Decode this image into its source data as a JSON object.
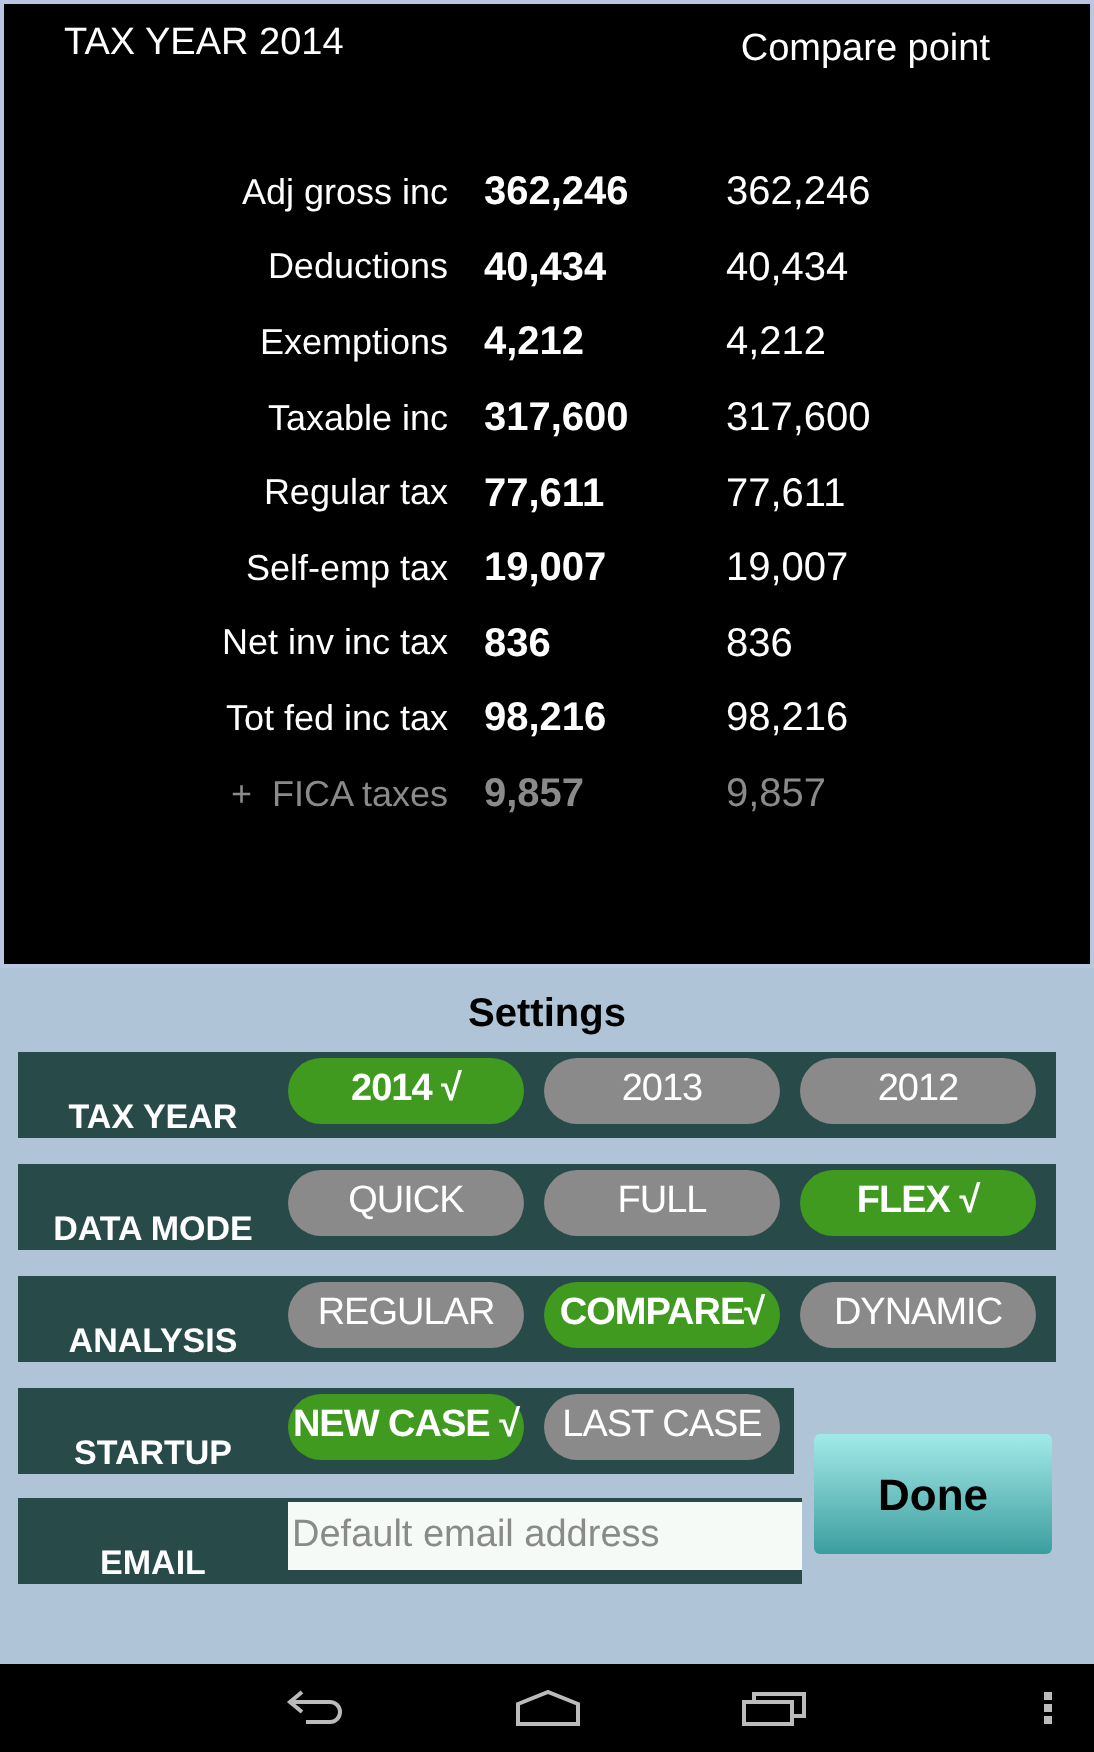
{
  "summary": {
    "title": "TAX YEAR 2014",
    "compare_heading": "Compare point",
    "rows": [
      {
        "label": "Adj gross inc",
        "value": "362,246",
        "compare": "362,246",
        "muted": false
      },
      {
        "label": "Deductions",
        "value": "40,434",
        "compare": "40,434",
        "muted": false
      },
      {
        "label": "Exemptions",
        "value": "4,212",
        "compare": "4,212",
        "muted": false
      },
      {
        "label": "Taxable inc",
        "value": "317,600",
        "compare": "317,600",
        "muted": false
      },
      {
        "label": "Regular tax",
        "value": "77,611",
        "compare": "77,611",
        "muted": false
      },
      {
        "label": "Self-emp tax",
        "value": "19,007",
        "compare": "19,007",
        "muted": false
      },
      {
        "label": "Net inv inc tax",
        "value": "836",
        "compare": "836",
        "muted": false
      },
      {
        "label": "Tot fed inc tax",
        "value": "98,216",
        "compare": "98,216",
        "muted": false
      },
      {
        "label": "+  FICA taxes",
        "value": "9,857",
        "compare": "9,857",
        "muted": true
      }
    ]
  },
  "settings": {
    "title": "Settings",
    "groups": [
      {
        "label": "TAX YEAR",
        "options": [
          {
            "label": "2014 √",
            "selected": true
          },
          {
            "label": "2013",
            "selected": false
          },
          {
            "label": "2012",
            "selected": false
          }
        ]
      },
      {
        "label": "DATA MODE",
        "options": [
          {
            "label": "QUICK",
            "selected": false
          },
          {
            "label": "FULL",
            "selected": false
          },
          {
            "label": "FLEX √",
            "selected": true
          }
        ]
      },
      {
        "label": "ANALYSIS",
        "options": [
          {
            "label": "REGULAR",
            "selected": false
          },
          {
            "label": "COMPARE√",
            "selected": true
          },
          {
            "label": "DYNAMIC",
            "selected": false
          }
        ]
      },
      {
        "label": "STARTUP",
        "options": [
          {
            "label": "NEW CASE √",
            "selected": true
          },
          {
            "label": "LAST CASE",
            "selected": false
          }
        ]
      }
    ],
    "email": {
      "label": "EMAIL",
      "placeholder": "Default email address"
    },
    "done_button": "Done"
  }
}
